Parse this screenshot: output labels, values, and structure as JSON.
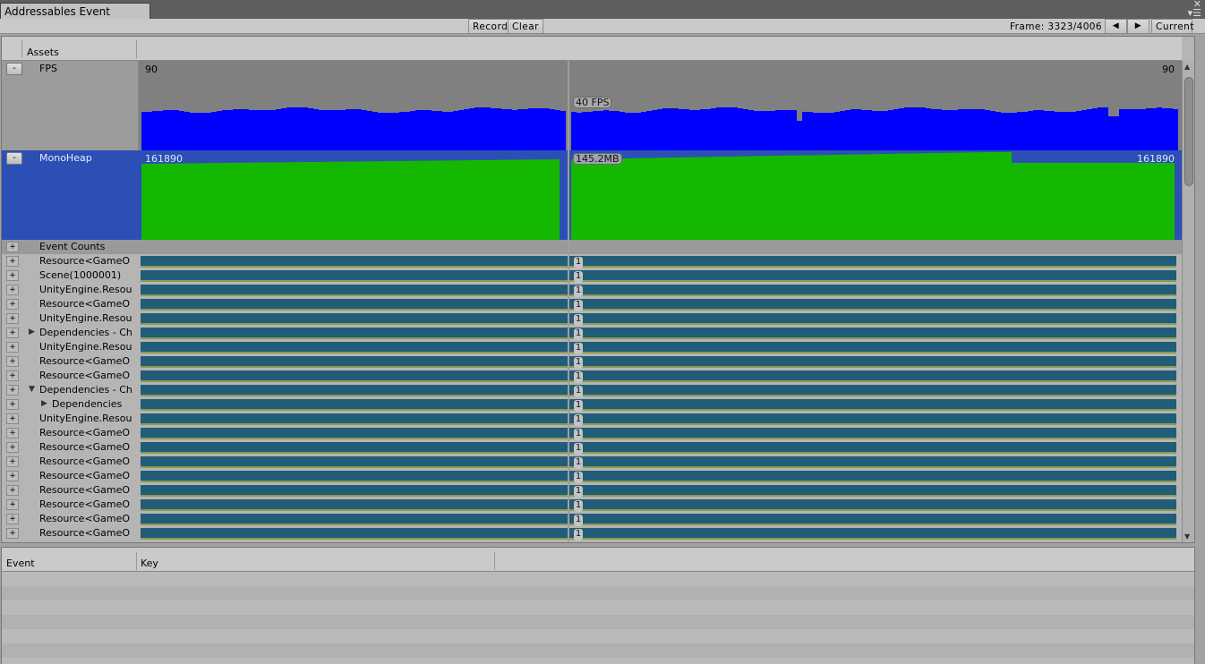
{
  "window": {
    "tab_title": "Addressables Event Viewer",
    "tab_controls": "✕\n▾☰"
  },
  "toolbar": {
    "record_label": "Record",
    "clear_label": "Clear",
    "frame_label": "Frame: 3323/4006",
    "prev_frame": "◀",
    "next_frame": "▶",
    "current_label": "Current"
  },
  "graph_header": {
    "title": "Assets"
  },
  "fps": {
    "name": "FPS",
    "toggle": "-",
    "left_max": "90",
    "right_max": "90",
    "cursor_value": "40 FPS",
    "color": "#0000ff",
    "background": "#808080"
  },
  "mono_heap": {
    "name": "MonoHeap",
    "toggle": "-",
    "left_max": "161890",
    "right_max": "161890",
    "cursor_value": "145.2MB",
    "color": "#14b800",
    "background": "#2c4fb5"
  },
  "events": [
    {
      "toggle": "+",
      "label": "Event Counts",
      "indent": 0,
      "has_bar": false
    },
    {
      "toggle": "+",
      "label": "Resource<GameO",
      "indent": 0,
      "count": "1"
    },
    {
      "toggle": "+",
      "label": "Scene(1000001)",
      "indent": 0,
      "count": "1"
    },
    {
      "toggle": "+",
      "label": "UnityEngine.Resou",
      "indent": 0,
      "count": "1"
    },
    {
      "toggle": "+",
      "label": "Resource<GameO",
      "indent": 0,
      "count": "1"
    },
    {
      "toggle": "+",
      "label": "UnityEngine.Resou",
      "indent": 0,
      "count": "1"
    },
    {
      "toggle": "+",
      "label": "Dependencies - Ch",
      "indent": 0,
      "tri": "▶",
      "count": "1"
    },
    {
      "toggle": "+",
      "label": "UnityEngine.Resou",
      "indent": 0,
      "count": "1"
    },
    {
      "toggle": "+",
      "label": "Resource<GameO",
      "indent": 0,
      "count": "1"
    },
    {
      "toggle": "+",
      "label": "Resource<GameO",
      "indent": 0,
      "count": "1"
    },
    {
      "toggle": "+",
      "label": "Dependencies - Ch",
      "indent": 0,
      "tri": "▼",
      "count": "1"
    },
    {
      "toggle": "+",
      "label": "Dependencies",
      "indent": 1,
      "tri": "▶",
      "count": "1"
    },
    {
      "toggle": "+",
      "label": "UnityEngine.Resou",
      "indent": 0,
      "count": "1"
    },
    {
      "toggle": "+",
      "label": "Resource<GameO",
      "indent": 0,
      "count": "1"
    },
    {
      "toggle": "+",
      "label": "Resource<GameO",
      "indent": 0,
      "count": "1"
    },
    {
      "toggle": "+",
      "label": "Resource<GameO",
      "indent": 0,
      "count": "1"
    },
    {
      "toggle": "+",
      "label": "Resource<GameO",
      "indent": 0,
      "count": "1"
    },
    {
      "toggle": "+",
      "label": "Resource<GameO",
      "indent": 0,
      "count": "1"
    },
    {
      "toggle": "+",
      "label": "Resource<GameO",
      "indent": 0,
      "count": "1"
    },
    {
      "toggle": "+",
      "label": "Resource<GameO",
      "indent": 0,
      "count": "1"
    },
    {
      "toggle": "+",
      "label": "Resource<GameO",
      "indent": 0,
      "count": "1"
    }
  ],
  "event_table": {
    "columns": [
      "Event",
      "Key"
    ]
  },
  "icons": {
    "scroll_up": "triangle-up-icon",
    "scroll_down": "triangle-down-icon",
    "expand": "triangle-right-icon",
    "collapse": "triangle-down-icon"
  }
}
